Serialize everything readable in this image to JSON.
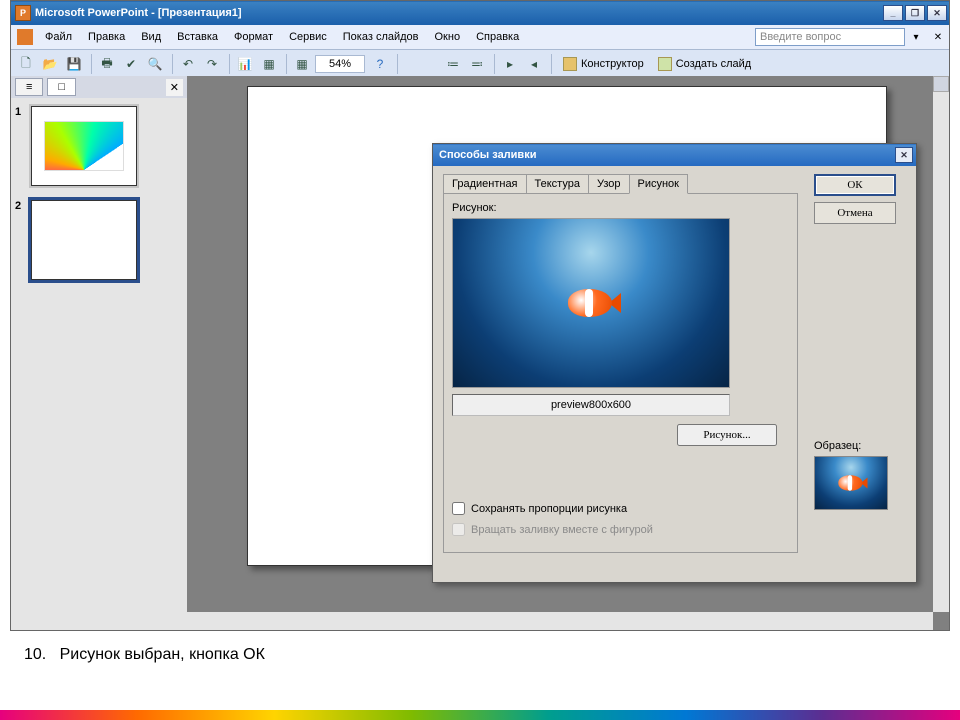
{
  "titlebar": {
    "app_name": "Microsoft PowerPoint",
    "doc_name": "[Презентация1]"
  },
  "window_controls": {
    "minimize": "_",
    "restore": "❐",
    "close": "✕"
  },
  "doc_controls": {
    "close": "✕"
  },
  "menu": {
    "file": "Файл",
    "edit": "Правка",
    "view": "Вид",
    "insert": "Вставка",
    "format": "Формат",
    "tools": "Сервис",
    "slideshow": "Показ слайдов",
    "window": "Окно",
    "help": "Справка"
  },
  "question_placeholder": "Введите вопрос",
  "menu_tail_chevron": "▾",
  "toolbar": {
    "zoom_value": "54%",
    "designer_label": "Конструктор",
    "new_slide_label": "Создать слайд"
  },
  "pane_tabs": {
    "outline": "≡",
    "slides": "□",
    "close": "✕"
  },
  "thumbs": [
    {
      "num": "1"
    },
    {
      "num": "2"
    }
  ],
  "dialog": {
    "title": "Способы заливки",
    "tabs": {
      "gradient": "Градиентная",
      "texture": "Текстура",
      "pattern": "Узор",
      "picture": "Рисунок"
    },
    "picture_label": "Рисунок:",
    "filename": "preview800x600",
    "browse_btn": "Рисунок...",
    "keep_aspect": "Сохранять пропорции рисунка",
    "rotate_with_shape": "Вращать заливку вместе с фигурой",
    "ok": "ОК",
    "cancel": "Отмена",
    "sample_label": "Образец:"
  },
  "caption": {
    "num": "10.",
    "text": "Рисунок выбран, кнопка ОК"
  }
}
